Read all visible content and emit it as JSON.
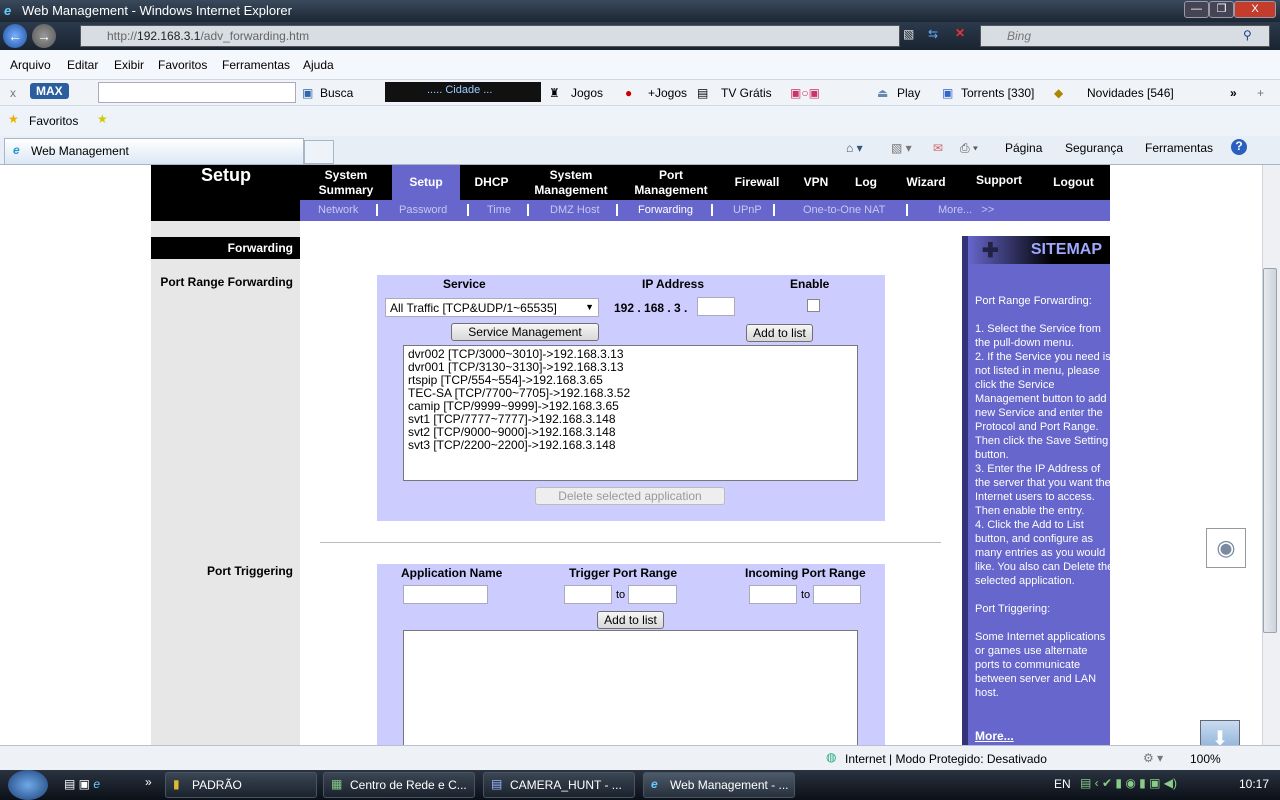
{
  "window": {
    "title": "Web Management - Windows Internet Explorer",
    "min": "—",
    "max": "❐",
    "close": "X"
  },
  "address": {
    "url_prefix": "http://",
    "url_host": "192.168.3.1",
    "url_path": "/adv_forwarding.htm",
    "search_placeholder": "Bing"
  },
  "menu": [
    "Arquivo",
    "Editar",
    "Exibir",
    "Favoritos",
    "Ferramentas",
    "Ajuda"
  ],
  "toolbar": {
    "close": "x",
    "brand": "MAX",
    "busca": "Busca",
    "radio": "..... Cidade ...",
    "jogos": "Jogos",
    "mais_jogos": "+Jogos",
    "tv": "TV Grátis",
    "play": "Play",
    "torrents": "Torrents [330]",
    "novidades": "Novidades [546]",
    "more": "»",
    "add": "+"
  },
  "favorites": {
    "label": "Favoritos"
  },
  "tab": {
    "title": "Web Management"
  },
  "commandbar": {
    "pagina": "Página",
    "seguranca": "Segurança",
    "ferramentas": "Ferramentas",
    "help": "?"
  },
  "router": {
    "section": "Setup",
    "nav": [
      {
        "label": "System Summary"
      },
      {
        "label": "Setup",
        "active": true
      },
      {
        "label": "DHCP"
      },
      {
        "label": "System Management"
      },
      {
        "label": "Port Management"
      },
      {
        "label": "Firewall"
      },
      {
        "label": "VPN"
      },
      {
        "label": "Log"
      },
      {
        "label": "Wizard"
      },
      {
        "label": "Support"
      },
      {
        "label": "Logout"
      }
    ],
    "subnav": [
      {
        "label": "Network"
      },
      {
        "label": "Password"
      },
      {
        "label": "Time"
      },
      {
        "label": "DMZ Host"
      },
      {
        "label": "Forwarding",
        "active": true
      },
      {
        "label": "UPnP"
      },
      {
        "label": "One-to-One NAT"
      },
      {
        "label": "More...   >>"
      }
    ],
    "left_header": "Forwarding",
    "port_range": {
      "label": "Port Range Forwarding",
      "col_service": "Service",
      "col_ip": "IP Address",
      "col_enable": "Enable",
      "service_selected": "All Traffic [TCP&UDP/1~65535]",
      "ip_prefix": "192 . 168 . 3 .",
      "ip_last": "",
      "enabled": false,
      "service_mgmt_btn": "Service Management",
      "add_btn": "Add to list",
      "entries": [
        "dvr002 [TCP/3000~3010]->192.168.3.13",
        "dvr001 [TCP/3130~3130]->192.168.3.13",
        "rtspip [TCP/554~554]->192.168.3.65",
        "TEC-SA [TCP/7700~7705]->192.168.3.52",
        "camip [TCP/9999~9999]->192.168.3.65",
        "svt1 [TCP/7777~7777]->192.168.3.148",
        "svt2 [TCP/9000~9000]->192.168.3.148",
        "svt3 [TCP/2200~2200]->192.168.3.148"
      ],
      "delete_btn": "Delete selected application"
    },
    "port_trigger": {
      "label": "Port Triggering",
      "col_app": "Application Name",
      "col_trigger": "Trigger Port Range",
      "col_incoming": "Incoming Port Range",
      "to": "to",
      "add_btn": "Add to list"
    },
    "sitemap": {
      "title": "SITEMAP",
      "text": "Port Range Forwarding:\n\n1. Select the Service from the pull-down menu.\n2. If the Service you need is not listed in menu, please click the Service Management button to add new Service and enter the Protocol and Port Range. Then click the Save Setting button.\n3. Enter the IP Address of the server that you want the Internet users to access. Then enable the entry.\n4. Click the Add to List button, and configure as many entries as you would like. You also can Delete the selected application.\n\nPort Triggering:\n\nSome Internet applications or games use alternate ports to communicate between server and LAN host.",
      "more": "More..."
    }
  },
  "status": {
    "zone": "Internet | Modo Protegido: Desativado",
    "zoom": "100%"
  },
  "taskbar": {
    "items": [
      "PADRÃO",
      "Centro de Rede e C...",
      "CAMERA_HUNT - ...",
      "Web Management - ..."
    ],
    "lang": "EN",
    "clock": "10:17",
    "more": "»"
  }
}
